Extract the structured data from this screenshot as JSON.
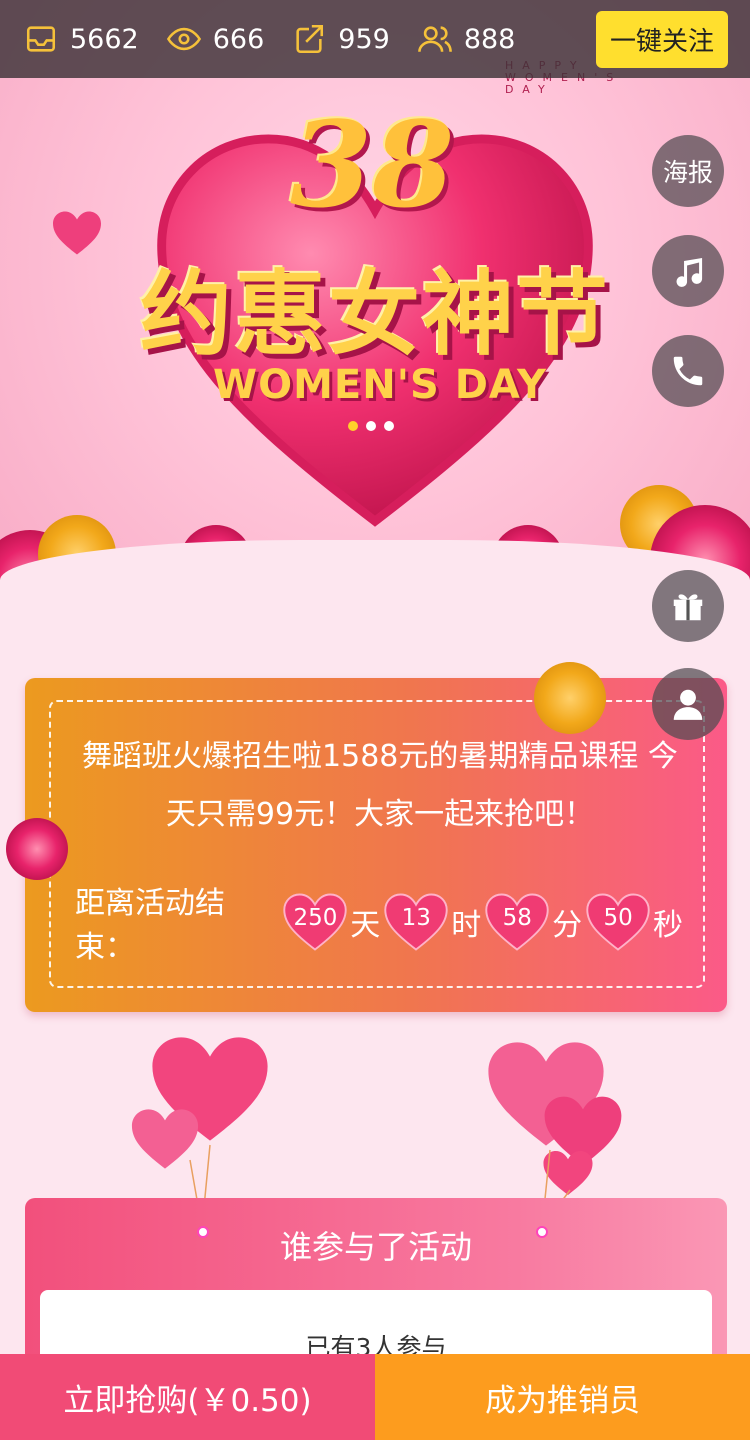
{
  "stats": {
    "items": [
      {
        "icon": "inbox-icon",
        "value": "5662"
      },
      {
        "icon": "eye-icon",
        "value": "666"
      },
      {
        "icon": "share-icon",
        "value": "959"
      },
      {
        "icon": "users-icon",
        "value": "888"
      }
    ],
    "follow_label": "一键关注"
  },
  "hero": {
    "title_number": "38",
    "title_cn": "约惠女神节",
    "title_en": "WOMEN'S DAY",
    "tagline": "HAPPY WOMEN'S DAY",
    "carousel_pages": 3,
    "carousel_active": 1
  },
  "side_buttons": {
    "poster_label": "海报",
    "music_icon": "music-note-icon",
    "phone_icon": "phone-icon",
    "gift_icon": "gift-icon",
    "user_icon": "user-icon"
  },
  "activity": {
    "description": "舞蹈班火爆招生啦1588元的暑期精品课程 今天只需99元！大家一起来抢吧！",
    "countdown_label": "距离活动结束：",
    "days": "250",
    "days_unit": "天",
    "hours": "13",
    "hours_unit": "时",
    "minutes": "58",
    "minutes_unit": "分",
    "seconds": "50",
    "seconds_unit": "秒"
  },
  "participants": {
    "title": "谁参与了活动",
    "count_text": "已有3人参与"
  },
  "bottom": {
    "buy_label": "立即抢购(￥0.50)",
    "promoter_label": "成为推销员"
  },
  "colors": {
    "accent_yellow": "#ffdf2e",
    "buy_pink": "#f14b76",
    "promoter_orange": "#fd9c1e"
  }
}
